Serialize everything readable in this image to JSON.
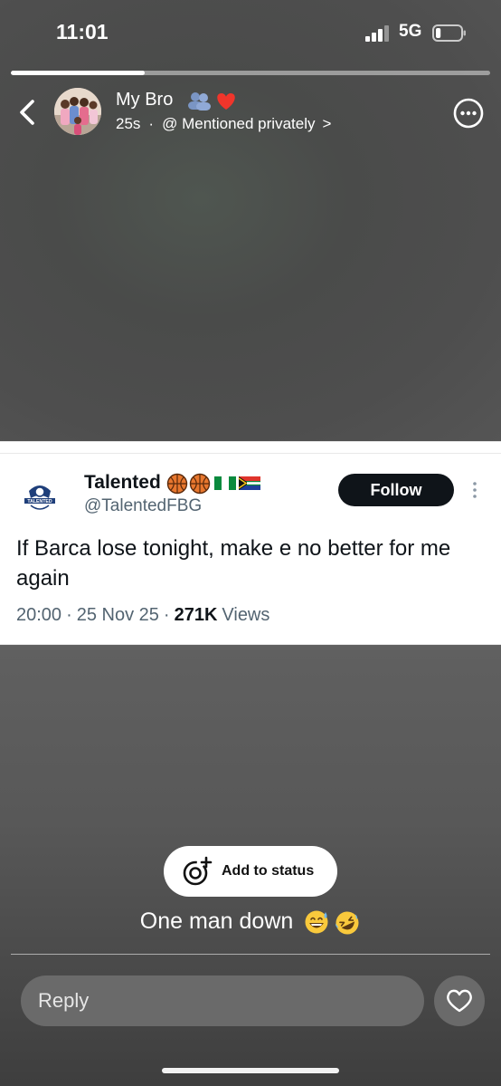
{
  "status_bar": {
    "time": "11:01",
    "network": "5G",
    "signal_icon": "cellular-signal-icon",
    "battery_icon": "battery-icon",
    "battery_level": 0.2
  },
  "story": {
    "progress": 0.28,
    "contact_name": "My Bro",
    "name_emojis": "busts-in-silhouette, red-heart",
    "elapsed": "25s",
    "visibility": "@ Mentioned privately",
    "visibility_chevron": ">",
    "caption": "One man down",
    "caption_emojis": "grinning-face-with-sweat, rolling-on-the-floor-laughing"
  },
  "tweet": {
    "author_name": "Talented",
    "name_emojis": "basketball, basketball, flag-nigeria, flag-south-africa",
    "handle": "@TalentedFBG",
    "follow_label": "Follow",
    "text": "If Barca lose tonight, make e no better for me again",
    "time": "20:00",
    "date": "25 Nov 25",
    "views_count": "271K",
    "views_label": "Views",
    "separator": "·",
    "logo_label": "TALENTED"
  },
  "actions": {
    "add_to_status_label": "Add to status",
    "reply_placeholder": "Reply"
  },
  "colors": {
    "follow_button": "#0f1419",
    "handle_text": "#536471",
    "reply_field": "#6a6a6a"
  }
}
